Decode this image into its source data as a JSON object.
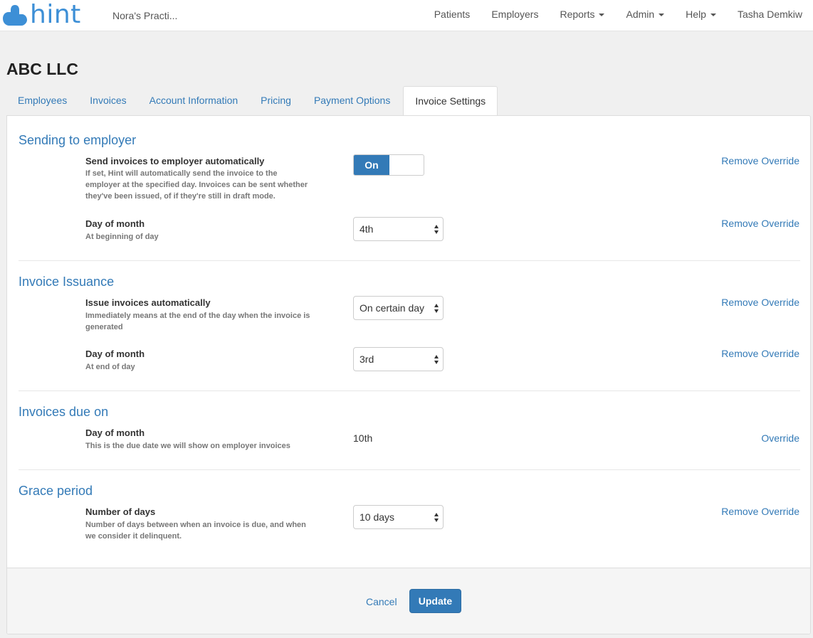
{
  "brand": {
    "name": "hint",
    "color": "#3d8fd6"
  },
  "navbar": {
    "practice": "Nora's Practi...",
    "items": [
      {
        "label": "Patients",
        "dropdown": false
      },
      {
        "label": "Employers",
        "dropdown": false
      },
      {
        "label": "Reports",
        "dropdown": true
      },
      {
        "label": "Admin",
        "dropdown": true
      },
      {
        "label": "Help",
        "dropdown": true
      },
      {
        "label": "Tasha Demkiw",
        "dropdown": false
      }
    ]
  },
  "page_title": "ABC LLC",
  "tabs": [
    {
      "label": "Employees",
      "active": false
    },
    {
      "label": "Invoices",
      "active": false
    },
    {
      "label": "Account Information",
      "active": false
    },
    {
      "label": "Pricing",
      "active": false
    },
    {
      "label": "Payment Options",
      "active": false
    },
    {
      "label": "Invoice Settings",
      "active": true
    }
  ],
  "sections": {
    "sending": {
      "title": "Sending to employer",
      "auto_send": {
        "label": "Send invoices to employer automatically",
        "help_lines": [
          "If set, Hint will automatically send the invoice to the",
          "employer at the specified day. Invoices can be sent whether",
          "they've been issued, of if they're still in draft mode."
        ],
        "toggle_label": "On",
        "link": "Remove Override"
      },
      "day_of_month": {
        "label": "Day of month",
        "help": "At beginning of day",
        "value": "4th",
        "link": "Remove Override"
      }
    },
    "issuance": {
      "title": "Invoice Issuance",
      "issue_auto": {
        "label": "Issue invoices automatically",
        "help_lines": [
          "Immediately means at the end of the day when the invoice is",
          "generated"
        ],
        "value": "On certain day",
        "link": "Remove Override"
      },
      "day_of_month": {
        "label": "Day of month",
        "help": "At end of day",
        "value": "3rd",
        "link": "Remove Override"
      }
    },
    "due": {
      "title": "Invoices due on",
      "day_of_month": {
        "label": "Day of month",
        "help": "This is the due date we will show on employer invoices",
        "value": "10th",
        "link": "Override"
      }
    },
    "grace": {
      "title": "Grace period",
      "days": {
        "label": "Number of days",
        "help_lines": [
          "Number of days between when an invoice is due, and when",
          "we consider it delinquent."
        ],
        "value": "10 days",
        "link": "Remove Override"
      }
    }
  },
  "footer": {
    "cancel": "Cancel",
    "update": "Update"
  },
  "colors": {
    "link": "#337ab7",
    "primary": "#337ab7",
    "background": "#f0f0f0"
  }
}
